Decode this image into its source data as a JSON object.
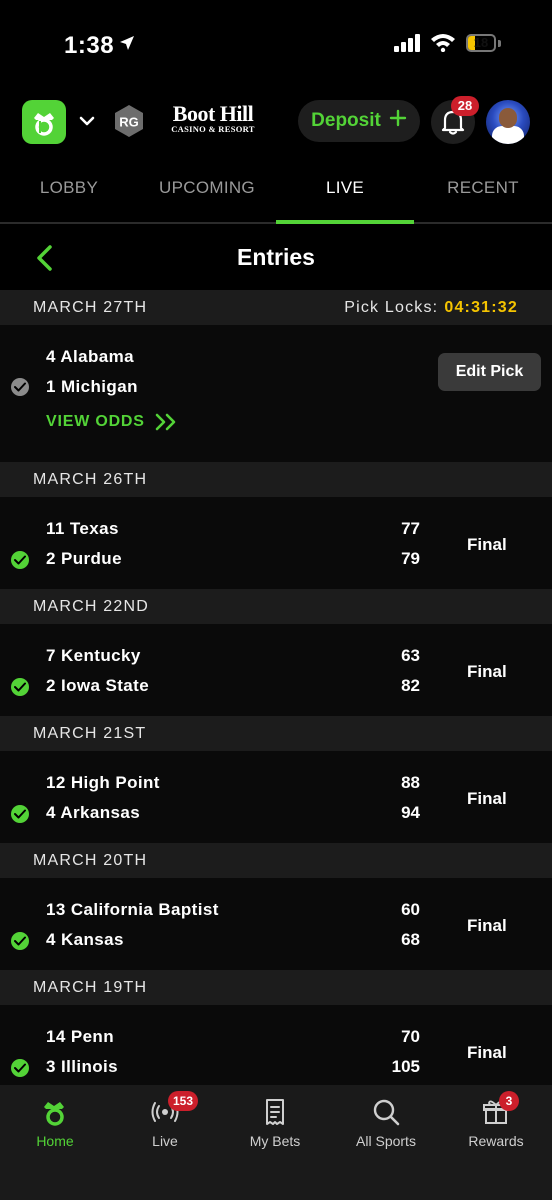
{
  "status_bar": {
    "time": "1:38",
    "battery": "18"
  },
  "header": {
    "rg_label": "RG",
    "partner_name": "Boot Hill",
    "partner_sub": "CASINO & RESORT",
    "deposit_label": "Deposit",
    "notifications_count": "28"
  },
  "tabs": [
    {
      "label": "LOBBY"
    },
    {
      "label": "UPCOMING"
    },
    {
      "label": "LIVE",
      "active": true
    },
    {
      "label": "RECENT"
    }
  ],
  "page": {
    "title": "Entries"
  },
  "entries": [
    {
      "date": "MARCH 27TH",
      "pick_locks_label": "Pick Locks:",
      "pick_locks_time": "04:31:32",
      "team1": "4 Alabama",
      "team2": "1 Michigan",
      "view_odds": "VIEW ODDS",
      "edit_pick": "Edit Pick"
    },
    {
      "date": "MARCH 26TH",
      "team1": "11 Texas",
      "score1": "77",
      "team2": "2 Purdue",
      "score2": "79",
      "status": "Final"
    },
    {
      "date": "MARCH 22ND",
      "team1": "7 Kentucky",
      "score1": "63",
      "team2": "2 Iowa State",
      "score2": "82",
      "status": "Final"
    },
    {
      "date": "MARCH 21ST",
      "team1": "12 High Point",
      "score1": "88",
      "team2": "4 Arkansas",
      "score2": "94",
      "status": "Final"
    },
    {
      "date": "MARCH 20TH",
      "team1": "13 California Baptist",
      "score1": "60",
      "team2": "4 Kansas",
      "score2": "68",
      "status": "Final"
    },
    {
      "date": "MARCH 19TH",
      "team1": "14 Penn",
      "score1": "70",
      "team2": "3 Illinois",
      "score2": "105",
      "status": "Final"
    }
  ],
  "bottom_nav": [
    {
      "label": "Home",
      "icon": "home-crown-icon",
      "active": true
    },
    {
      "label": "Live",
      "icon": "live-broadcast-icon",
      "badge": "153"
    },
    {
      "label": "My Bets",
      "icon": "receipt-icon"
    },
    {
      "label": "All Sports",
      "icon": "search-icon"
    },
    {
      "label": "Rewards",
      "icon": "gift-icon",
      "badge": "3"
    }
  ],
  "colors": {
    "accent_green": "#53d337",
    "countdown_yellow": "#f5c400",
    "badge_red": "#cc1f2b",
    "band_gray": "#1c1c1c"
  }
}
